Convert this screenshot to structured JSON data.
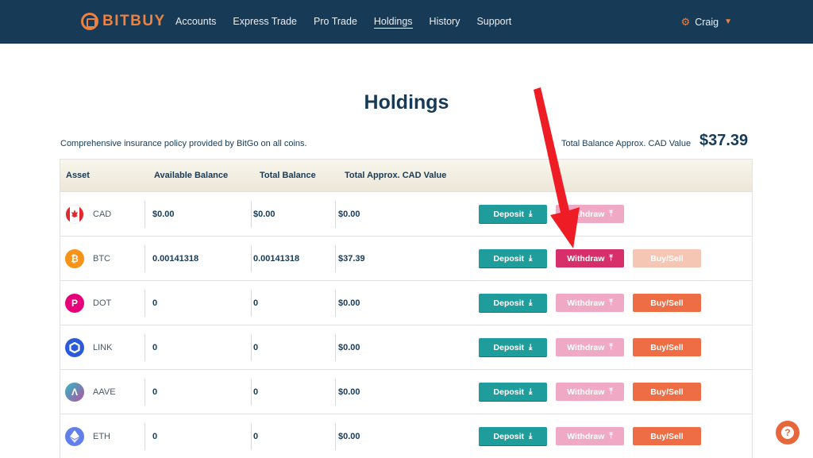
{
  "brand": {
    "name": "BITBUY",
    "color": "#ee8040"
  },
  "nav": {
    "items": [
      {
        "label": "Accounts"
      },
      {
        "label": "Express Trade"
      },
      {
        "label": "Pro Trade"
      },
      {
        "label": "Holdings",
        "active": true
      },
      {
        "label": "History"
      },
      {
        "label": "Support"
      }
    ],
    "user": "Craig"
  },
  "page": {
    "title": "Holdings",
    "insurance_note": "Comprehensive insurance policy provided by BitGo on all coins.",
    "total_label": "Total Balance Approx. CAD Value",
    "total_value": "$37.39"
  },
  "table": {
    "headers": [
      "Asset",
      "Available Balance",
      "Total Balance",
      "Total Approx. CAD Value"
    ],
    "buttons": {
      "deposit": "Deposit",
      "withdraw": "Withdraw",
      "buysell": "Buy/Sell"
    },
    "rows": [
      {
        "asset": "CAD",
        "icon": "canada-flag-icon",
        "available": "$0.00",
        "total": "$0.00",
        "cad_value": "$0.00",
        "withdraw_enabled": false,
        "has_buysell": false
      },
      {
        "asset": "BTC",
        "icon": "bitcoin-icon",
        "available": "0.00141318",
        "total": "0.00141318",
        "cad_value": "$37.39",
        "withdraw_enabled": true,
        "buysell_enabled": false,
        "has_buysell": true
      },
      {
        "asset": "DOT",
        "icon": "polkadot-icon",
        "available": "0",
        "total": "0",
        "cad_value": "$0.00",
        "withdraw_enabled": false,
        "buysell_enabled": true,
        "has_buysell": true
      },
      {
        "asset": "LINK",
        "icon": "chainlink-icon",
        "available": "0",
        "total": "0",
        "cad_value": "$0.00",
        "withdraw_enabled": false,
        "buysell_enabled": true,
        "has_buysell": true
      },
      {
        "asset": "AAVE",
        "icon": "aave-icon",
        "available": "0",
        "total": "0",
        "cad_value": "$0.00",
        "withdraw_enabled": false,
        "buysell_enabled": true,
        "has_buysell": true
      },
      {
        "asset": "ETH",
        "icon": "ethereum-icon",
        "available": "0",
        "total": "0",
        "cad_value": "$0.00",
        "withdraw_enabled": false,
        "buysell_enabled": true,
        "has_buysell": true
      }
    ]
  },
  "colors": {
    "nav_bg": "#173a57",
    "deposit": "#1e9d9c",
    "withdraw_active": "#d62f6a",
    "withdraw_disabled": "#f0a9c4",
    "buysell": "#ee6d45",
    "annotation_arrow": "#ee1c25"
  }
}
